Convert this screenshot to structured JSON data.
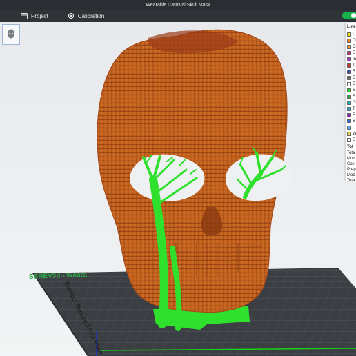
{
  "window": {
    "title": "Wearable Carnival Skull Mask"
  },
  "tabs": [
    {
      "label": "Project",
      "icon": "folder-icon"
    },
    {
      "label": "Calibration",
      "icon": "gear-icon"
    }
  ],
  "plate_label": "SEREV3d - Weara",
  "plate_side_text": "Bambu Textured PEI Plate",
  "legend": {
    "header": "Line",
    "items": [
      {
        "label": "I",
        "color": "#f2e400"
      },
      {
        "label": "O",
        "color": "#ff7d1a"
      },
      {
        "label": "O",
        "color": "#ff9e2c"
      },
      {
        "label": "S",
        "color": "#c8286e"
      },
      {
        "label": "In",
        "color": "#b02fc8"
      },
      {
        "label": "T",
        "color": "#d42b2b"
      },
      {
        "label": "B",
        "color": "#3a46b0"
      },
      {
        "label": "B",
        "color": "#6b6b6b"
      },
      {
        "label": "B",
        "color": "#ffffff"
      },
      {
        "label": "S",
        "color": "#18d418"
      },
      {
        "label": "S",
        "color": "#2fa64d"
      },
      {
        "label": "G",
        "color": "#19b3a0"
      },
      {
        "label": "T",
        "color": "#1fb0d8"
      },
      {
        "label": "R",
        "color": "#8b1db8"
      },
      {
        "label": "B",
        "color": "#3465d4"
      },
      {
        "label": "U",
        "color": "#4fb2e8"
      },
      {
        "label": "W",
        "color": "#e8e03a"
      },
      {
        "label": "S",
        "color": "#ffffff"
      }
    ],
    "totals_header": "Tot",
    "totals": [
      "Tota",
      "Mod",
      "Cos",
      "Prep",
      "Mod",
      "Tota"
    ]
  },
  "colors": {
    "mask": "#c9631f",
    "support": "#2fe02c",
    "plate": "#3e4146",
    "accent": "#16b24a"
  }
}
